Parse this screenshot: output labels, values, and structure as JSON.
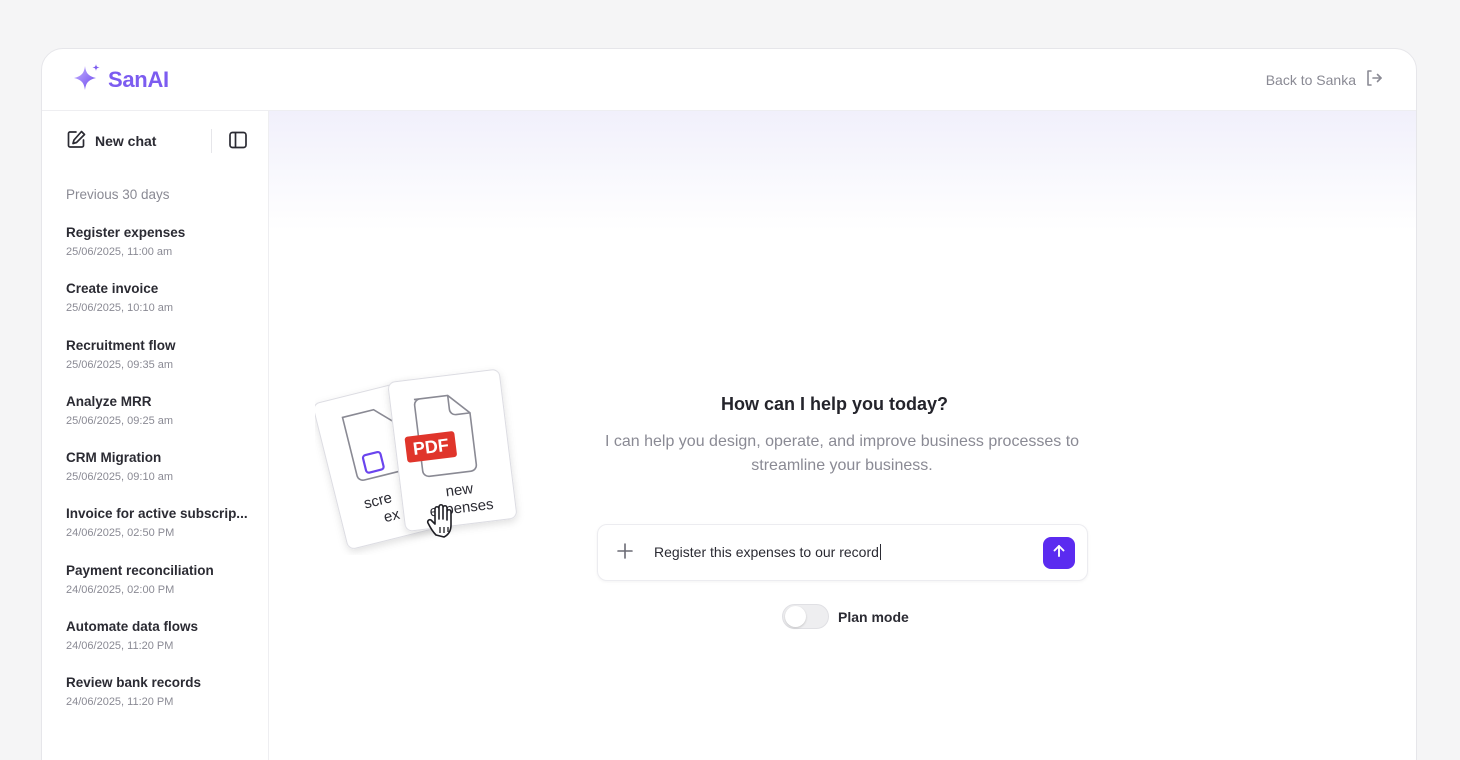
{
  "brand": {
    "name": "SanAI",
    "icon": "sparkle-icon",
    "color": "#7c5cf0"
  },
  "topbar": {
    "back_label": "Back to Sanka",
    "back_icon": "logout-arrow-icon"
  },
  "sidebar": {
    "new_chat_label": "New chat",
    "section_label": "Previous 30 days",
    "items": [
      {
        "title": "Register expenses",
        "date": "25/06/2025, 11:00 am"
      },
      {
        "title": "Create invoice",
        "date": "25/06/2025, 10:10 am"
      },
      {
        "title": "Recruitment flow",
        "date": "25/06/2025, 09:35 am"
      },
      {
        "title": "Analyze MRR",
        "date": "25/06/2025, 09:25 am"
      },
      {
        "title": "CRM Migration",
        "date": "25/06/2025, 09:10 am"
      },
      {
        "title": "Invoice for active subscrip...",
        "date": "24/06/2025, 02:50 PM"
      },
      {
        "title": "Payment reconciliation",
        "date": "24/06/2025, 02:00 PM"
      },
      {
        "title": "Automate data flows",
        "date": "24/06/2025, 11:20 PM"
      },
      {
        "title": "Review bank records",
        "date": "24/06/2025, 11:20 PM"
      }
    ]
  },
  "main": {
    "title": "How can I help you today?",
    "subtitle": "I can help you design, operate, and improve business processes to streamline your business.",
    "prompt_text": "Register this expenses to our record",
    "plan_mode_label": "Plan mode",
    "plan_mode_on": false,
    "accent": "#5b2bf0"
  },
  "illustration": {
    "back_card_text_1": "scre",
    "back_card_text_2": "ex",
    "badge": "PDF",
    "front_card_line_1": "new",
    "front_card_line_2": "expenses",
    "badge_color": "#e0352b"
  }
}
